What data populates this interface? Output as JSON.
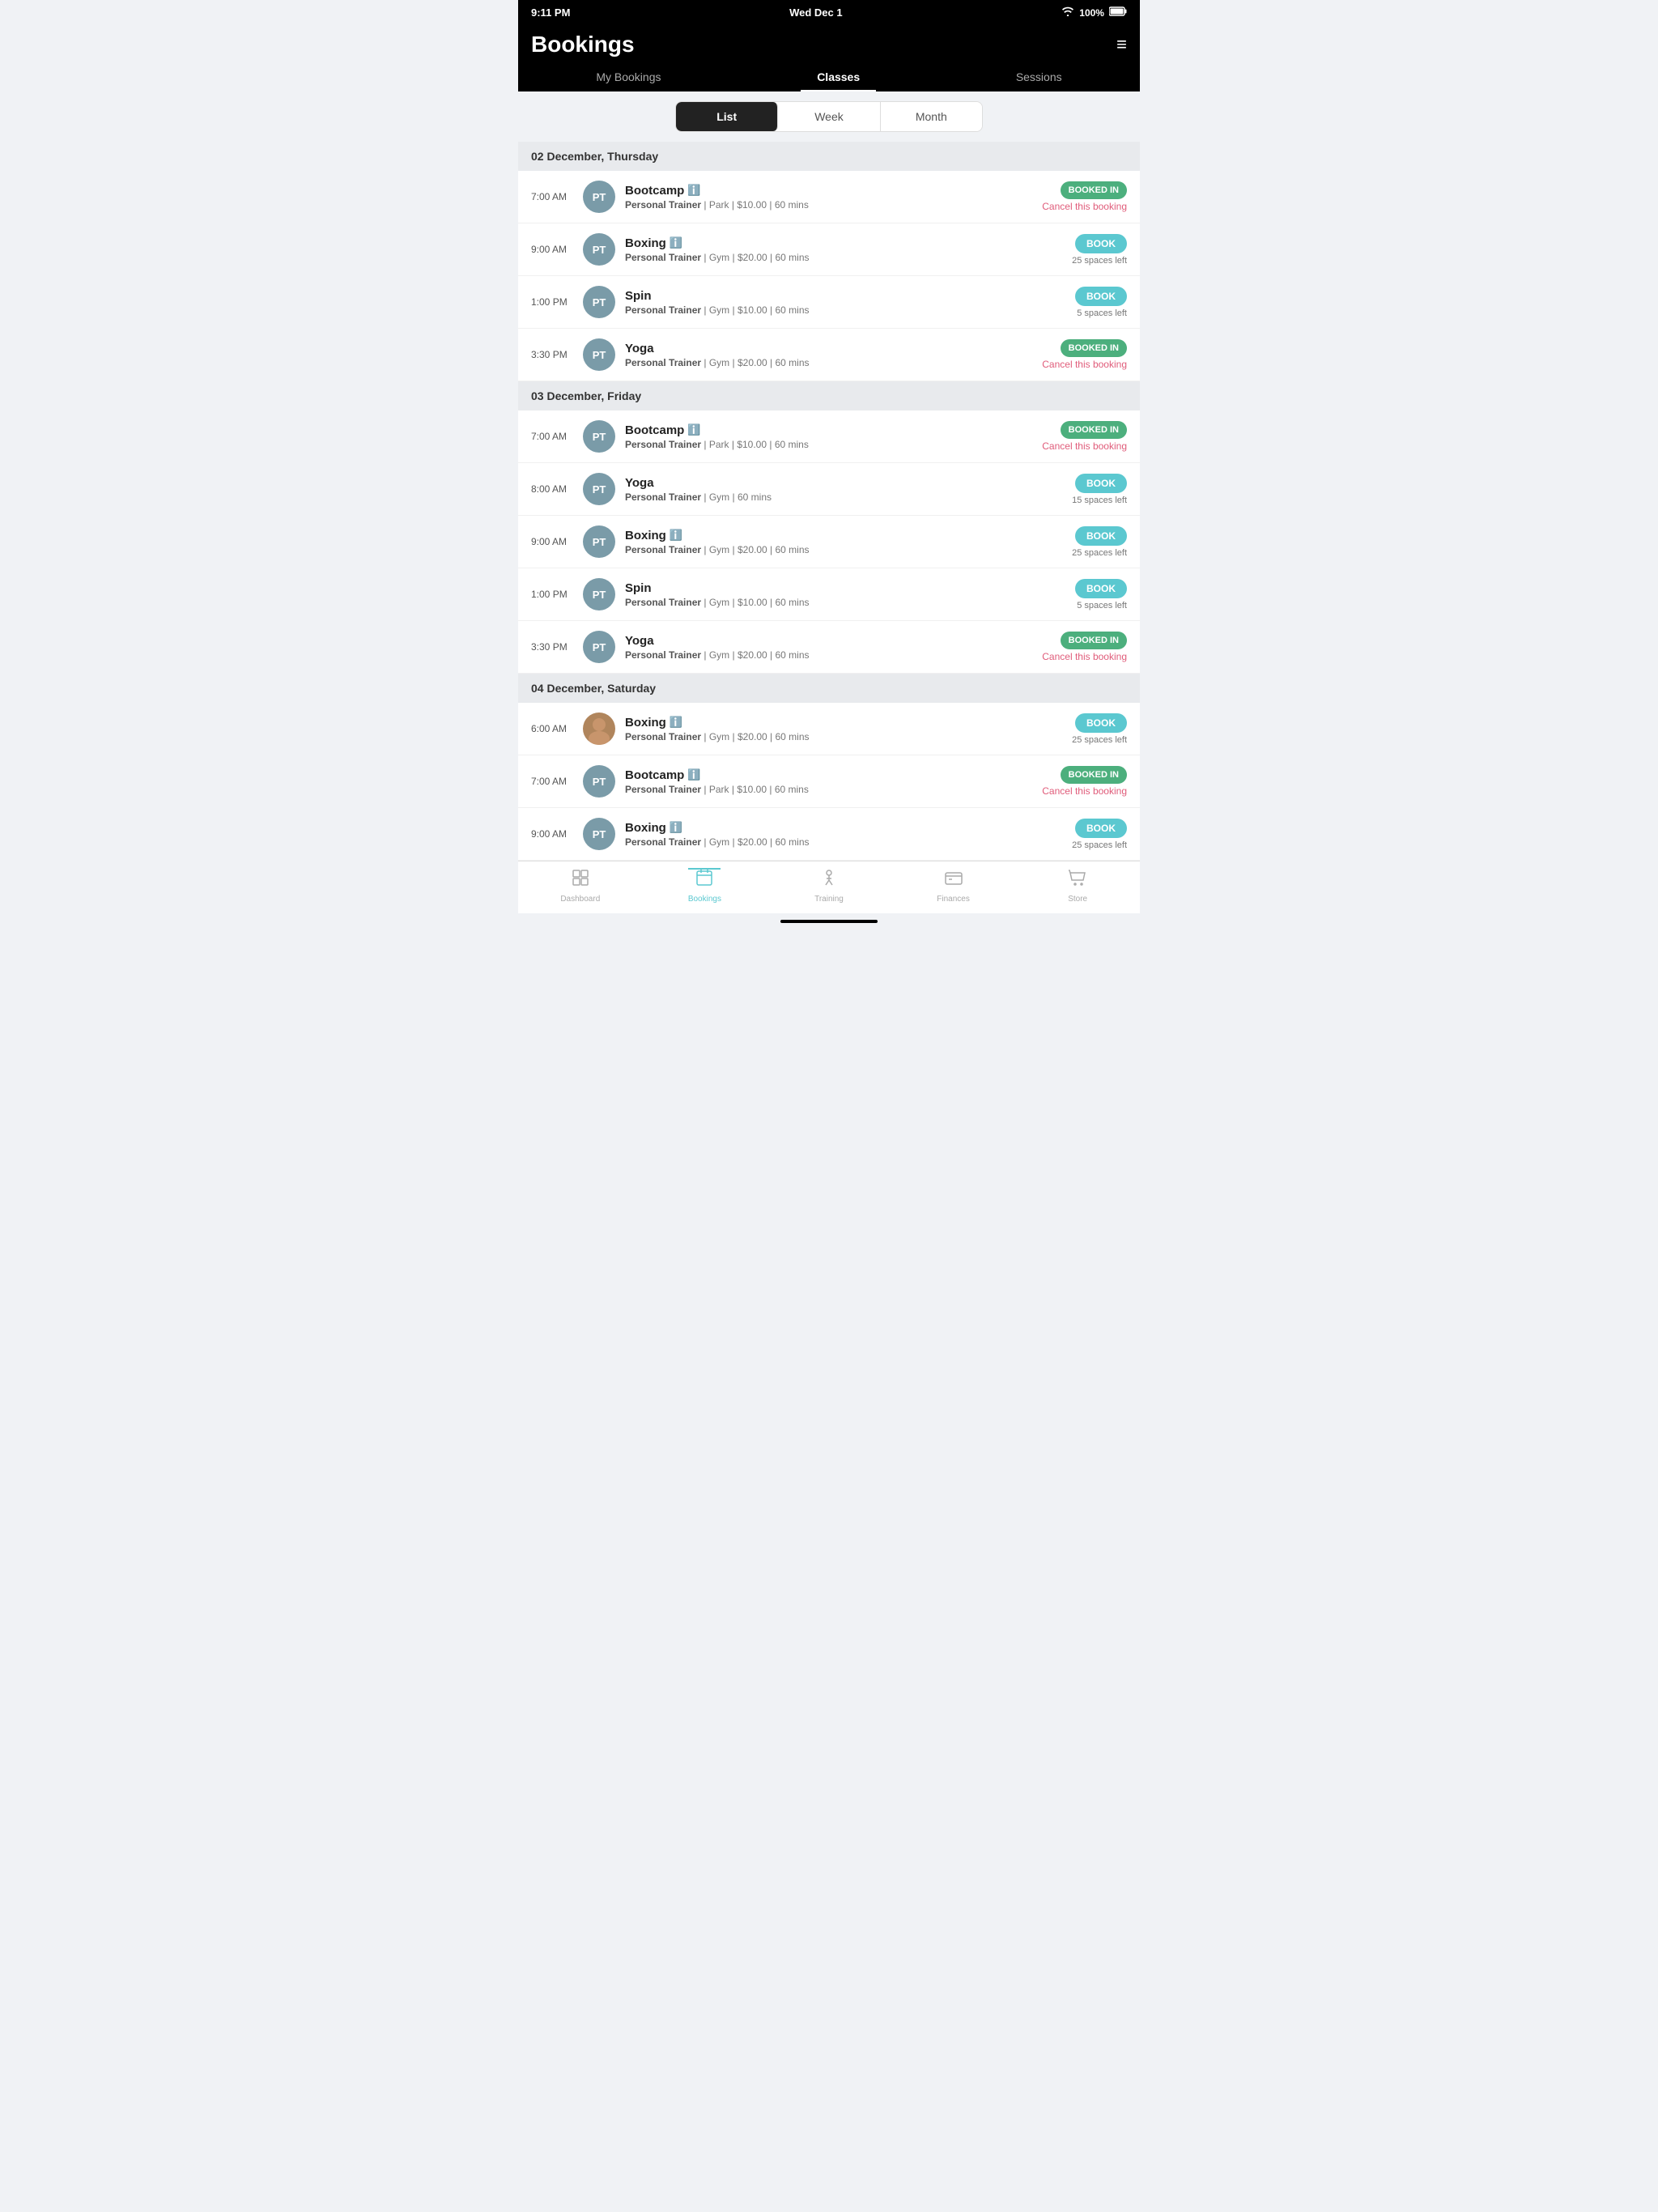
{
  "statusBar": {
    "time": "9:11 PM",
    "date": "Wed Dec 1",
    "battery": "100%",
    "wifi": true
  },
  "header": {
    "title": "Bookings",
    "menuIcon": "≡"
  },
  "navTabs": [
    {
      "id": "my-bookings",
      "label": "My Bookings",
      "active": false
    },
    {
      "id": "classes",
      "label": "Classes",
      "active": true
    },
    {
      "id": "sessions",
      "label": "Sessions",
      "active": false
    }
  ],
  "viewToggle": {
    "options": [
      {
        "id": "list",
        "label": "List",
        "active": true
      },
      {
        "id": "week",
        "label": "Week",
        "active": false
      },
      {
        "id": "month",
        "label": "Month",
        "active": false
      }
    ]
  },
  "days": [
    {
      "id": "dec02",
      "header": "02 December, Thursday",
      "classes": [
        {
          "id": "dec02-c1",
          "time": "7:00 AM",
          "avatar": "PT",
          "name": "Bootcamp",
          "trainer": "Personal Trainer",
          "location": "Park",
          "price": "$10.00",
          "duration": "60 mins",
          "status": "booked",
          "statusLabel": "BOOKED IN",
          "cancelLabel": "Cancel this booking",
          "hasInfo": true
        },
        {
          "id": "dec02-c2",
          "time": "9:00 AM",
          "avatar": "PT",
          "name": "Boxing",
          "trainer": "Personal Trainer",
          "location": "Gym",
          "price": "$20.00",
          "duration": "60 mins",
          "status": "available",
          "statusLabel": "BOOK",
          "spacesLeft": "25 spaces left",
          "hasInfo": true
        },
        {
          "id": "dec02-c3",
          "time": "1:00 PM",
          "avatar": "PT",
          "name": "Spin",
          "trainer": "Personal Trainer",
          "location": "Gym",
          "price": "$10.00",
          "duration": "60 mins",
          "status": "available",
          "statusLabel": "BOOK",
          "spacesLeft": "5 spaces left",
          "hasInfo": false
        },
        {
          "id": "dec02-c4",
          "time": "3:30 PM",
          "avatar": "PT",
          "name": "Yoga",
          "trainer": "Personal Trainer",
          "location": "Gym",
          "price": "$20.00",
          "duration": "60 mins",
          "status": "booked",
          "statusLabel": "BOOKED IN",
          "cancelLabel": "Cancel this booking",
          "hasInfo": false
        }
      ]
    },
    {
      "id": "dec03",
      "header": "03 December, Friday",
      "classes": [
        {
          "id": "dec03-c1",
          "time": "7:00 AM",
          "avatar": "PT",
          "name": "Bootcamp",
          "trainer": "Personal Trainer",
          "location": "Park",
          "price": "$10.00",
          "duration": "60 mins",
          "status": "booked",
          "statusLabel": "BOOKED IN",
          "cancelLabel": "Cancel this booking",
          "hasInfo": true
        },
        {
          "id": "dec03-c2",
          "time": "8:00 AM",
          "avatar": "PT",
          "name": "Yoga",
          "trainer": "Personal Trainer",
          "location": "Gym",
          "price": null,
          "duration": "60 mins",
          "status": "available",
          "statusLabel": "BOOK",
          "spacesLeft": "15 spaces left",
          "hasInfo": false
        },
        {
          "id": "dec03-c3",
          "time": "9:00 AM",
          "avatar": "PT",
          "name": "Boxing",
          "trainer": "Personal Trainer",
          "location": "Gym",
          "price": "$20.00",
          "duration": "60 mins",
          "status": "available",
          "statusLabel": "BOOK",
          "spacesLeft": "25 spaces left",
          "hasInfo": true
        },
        {
          "id": "dec03-c4",
          "time": "1:00 PM",
          "avatar": "PT",
          "name": "Spin",
          "trainer": "Personal Trainer",
          "location": "Gym",
          "price": "$10.00",
          "duration": "60 mins",
          "status": "available",
          "statusLabel": "BOOK",
          "spacesLeft": "5 spaces left",
          "hasInfo": false
        },
        {
          "id": "dec03-c5",
          "time": "3:30 PM",
          "avatar": "PT",
          "name": "Yoga",
          "trainer": "Personal Trainer",
          "location": "Gym",
          "price": "$20.00",
          "duration": "60 mins",
          "status": "booked",
          "statusLabel": "BOOKED IN",
          "cancelLabel": "Cancel this booking",
          "hasInfo": false
        }
      ]
    },
    {
      "id": "dec04",
      "header": "04 December, Saturday",
      "classes": [
        {
          "id": "dec04-c1",
          "time": "6:00 AM",
          "avatar": "photo",
          "name": "Boxing",
          "trainer": "Personal Trainer",
          "location": "Gym",
          "price": "$20.00",
          "duration": "60 mins",
          "status": "available",
          "statusLabel": "BOOK",
          "spacesLeft": "25 spaces left",
          "hasInfo": true
        },
        {
          "id": "dec04-c2",
          "time": "7:00 AM",
          "avatar": "PT",
          "name": "Bootcamp",
          "trainer": "Personal Trainer",
          "location": "Park",
          "price": "$10.00",
          "duration": "60 mins",
          "status": "booked",
          "statusLabel": "BOOKED IN",
          "cancelLabel": "Cancel this booking",
          "hasInfo": true
        },
        {
          "id": "dec04-c3",
          "time": "9:00 AM",
          "avatar": "PT",
          "name": "Boxing",
          "trainer": "Personal Trainer",
          "location": "Gym",
          "price": "$20.00",
          "duration": "60 mins",
          "status": "available",
          "statusLabel": "BOOK",
          "spacesLeft": "25 spaces left",
          "hasInfo": true
        }
      ]
    }
  ],
  "bottomNav": [
    {
      "id": "dashboard",
      "label": "Dashboard",
      "icon": "dashboard",
      "active": false
    },
    {
      "id": "bookings",
      "label": "Bookings",
      "icon": "bookings",
      "active": true
    },
    {
      "id": "training",
      "label": "Training",
      "icon": "training",
      "active": false
    },
    {
      "id": "finances",
      "label": "Finances",
      "icon": "finances",
      "active": false
    },
    {
      "id": "store",
      "label": "Store",
      "icon": "store",
      "active": false
    }
  ],
  "colors": {
    "booked": "#4caf7d",
    "book": "#5bc8d0",
    "cancel": "#e05c7a",
    "accent": "#5bc8d0"
  }
}
